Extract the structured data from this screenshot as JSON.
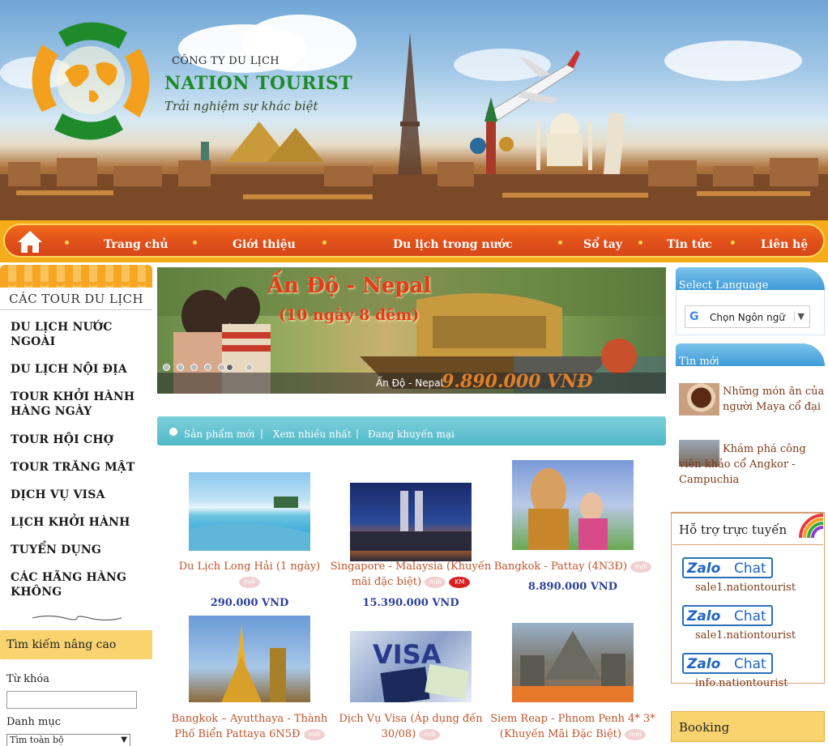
{
  "header": {
    "company_line": "CÔNG TY DU LỊCH",
    "company_name": "NATION TOURIST",
    "slogan": "Trải nghiệm sự khác biệt"
  },
  "nav": {
    "items": [
      "Trang chủ",
      "Giới thiệu",
      "Du lịch trong nước",
      "Sổ tay",
      "Tin tức",
      "Liên hệ"
    ]
  },
  "left": {
    "section_title": "CÁC TOUR DU LỊCH",
    "menu": [
      "DU LỊCH NƯỚC NGOÀI",
      "DU LỊCH NỘI ĐỊA",
      "TOUR KHỞI HÀNH HÀNG NGÀY",
      "TOUR HỘI CHỢ",
      "TOUR TRĂNG MẬT",
      "DỊCH VỤ VISA",
      "LỊCH KHỞI HÀNH",
      "TUYỂN DỤNG",
      "CÁC HÃNG HÀNG KHÔNG"
    ],
    "search": {
      "title": "Tìm kiếm nâng cao",
      "keyword_label": "Từ khóa",
      "keyword_value": "",
      "category_label": "Danh mục",
      "category_selected": "Tìm toàn bộ"
    }
  },
  "slider": {
    "title": "Ấn Độ - Nepal",
    "subtitle": "(10 ngày 8 đêm)",
    "caption": "Ấn Độ - Nepal",
    "price": "9.890.000 VNĐ",
    "active_dot": 4
  },
  "product_tabs": [
    "Sản phẩm mới",
    "Xem nhiều nhất",
    "Đang khuyến mại"
  ],
  "products": [
    {
      "name": "Du Lịch Long Hải (1 ngày)",
      "badges": [
        "mới"
      ],
      "price": "290.000 VND"
    },
    {
      "name": "Singapore - Malaysia (Khuyến mãi đặc biệt)",
      "badges": [
        "mới",
        "KM"
      ],
      "price": "15.390.000 VND"
    },
    {
      "name": "Bangkok - Pattay (4N3Đ)",
      "badges": [
        "mới"
      ],
      "price": "8.890.000 VND"
    },
    {
      "name": "Bangkok – Ayutthaya - Thành Phố Biển Pattaya 6N5Đ",
      "badges": [
        "mới"
      ],
      "price": ""
    },
    {
      "name": "Dịch Vụ Visa (Áp dụng đến 30/08)",
      "badges": [
        "mới"
      ],
      "price": ""
    },
    {
      "name": "Siem Reap - Phnom Penh 4* 3* (Khuyến Mãi Đặc Biệt)",
      "badges": [
        "mới"
      ],
      "price": ""
    }
  ],
  "right": {
    "language_title": "Select Language",
    "language_select": "Chọn Ngôn ngữ",
    "news_title": "Tin mới",
    "news": [
      "Những món ăn của người Maya cổ đại",
      "Khám phá công viên khảo cổ Angkor - Campuchia"
    ],
    "support_title": "Hỗ trợ trực tuyến",
    "zalo_label": "Chat",
    "contacts": [
      "sale1.nationtourist",
      "sale1.nationtourist",
      "info.nationtourist"
    ],
    "booking_title": "Booking"
  },
  "colors": {
    "nav_orange": "#e0501a",
    "brand_green": "#1f8a2a",
    "price_blue": "#2a3f9a",
    "tab_teal": "#4fb8c8",
    "accent_yellow": "#f9d36e"
  }
}
